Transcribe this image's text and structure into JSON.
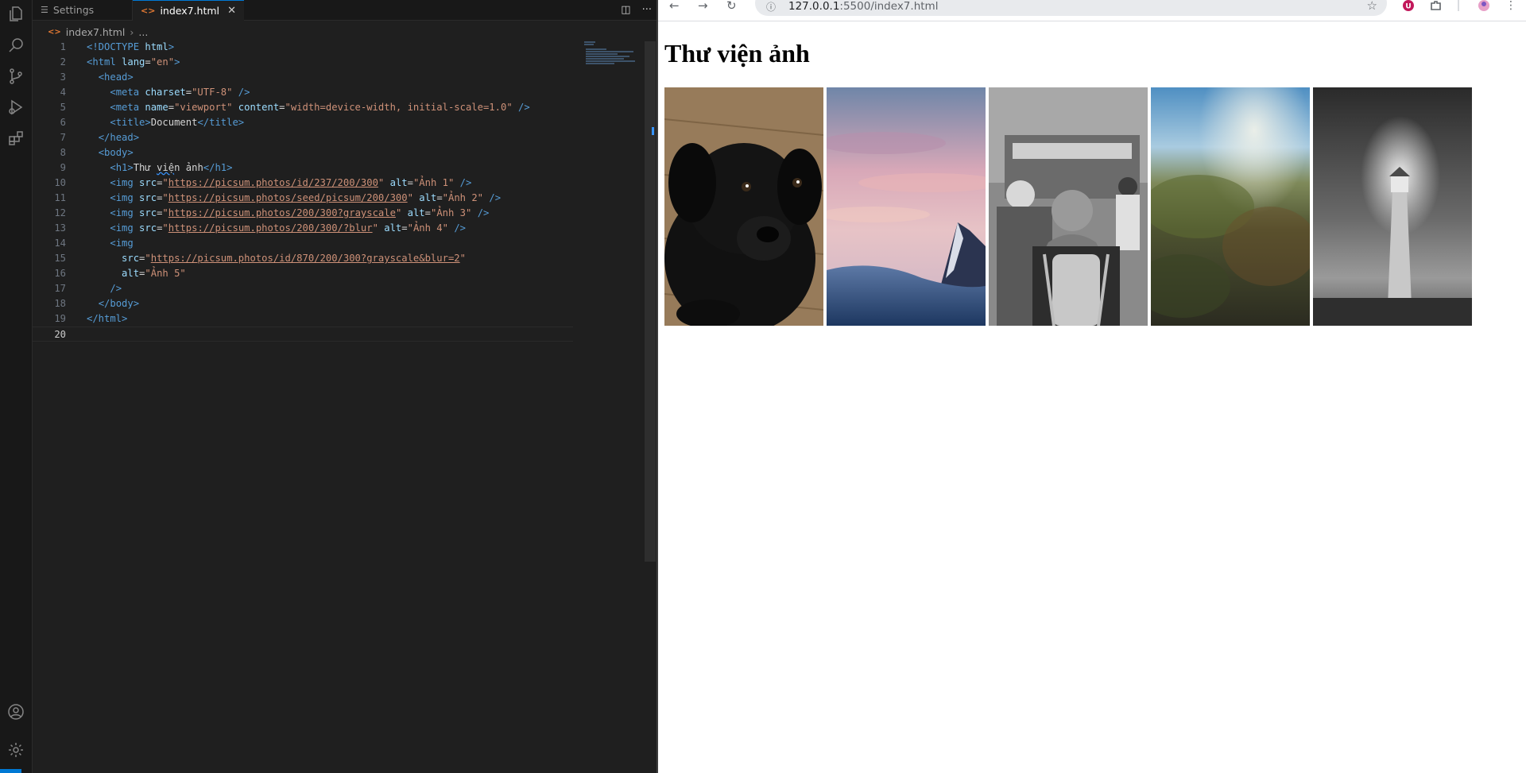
{
  "editor": {
    "tabs": [
      {
        "label": "Settings"
      },
      {
        "label": "index7.html"
      }
    ],
    "breadcrumb": {
      "file": "index7.html",
      "rest": "..."
    },
    "line_numbers": [
      "1",
      "2",
      "3",
      "4",
      "5",
      "6",
      "7",
      "8",
      "9",
      "10",
      "11",
      "12",
      "13",
      "14",
      "15",
      "16",
      "17",
      "18",
      "19",
      "20"
    ],
    "code": {
      "l1": {
        "a": "<!DOCTYPE",
        "b": " html",
        "c": ">"
      },
      "l2": {
        "a": "<html",
        "b": " lang",
        "c": "=",
        "d": "\"en\"",
        "e": ">"
      },
      "l3": {
        "a": "<head>"
      },
      "l4": {
        "a": "<meta",
        "b": " charset",
        "c": "=",
        "d": "\"UTF-8\"",
        "e": " />"
      },
      "l5": {
        "a": "<meta",
        "b": " name",
        "c": "=",
        "d": "\"viewport\"",
        "f": " content",
        "g": "=",
        "h": "\"width=device-width, initial-scale=1.0\"",
        "e": " />"
      },
      "l6": {
        "a": "<title>",
        "b": "Document",
        "c": "</title>"
      },
      "l7": {
        "a": "</head>"
      },
      "l8": {
        "a": "<body>"
      },
      "l9": {
        "a": "<h1>",
        "b": "Thư ",
        "sq": "việ",
        "c": "n ảnh",
        "d": "</h1>"
      },
      "l10": {
        "a": "<img",
        "b": " src",
        "c": "=",
        "q1": "\"",
        "u": "https://picsum.photos/id/237/200/300",
        "q2": "\"",
        "f": " alt",
        "g": "=",
        "h": "\"Ảnh 1\"",
        "e": " />"
      },
      "l11": {
        "a": "<img",
        "b": " src",
        "c": "=",
        "q1": "\"",
        "u": "https://picsum.photos/seed/picsum/200/300",
        "q2": "\"",
        "f": " alt",
        "g": "=",
        "h": "\"Ảnh 2\"",
        "e": " />"
      },
      "l12": {
        "a": "<img",
        "b": " src",
        "c": "=",
        "q1": "\"",
        "u": "https://picsum.photos/200/300?grayscale",
        "q2": "\"",
        "f": " alt",
        "g": "=",
        "h": "\"Ảnh 3\"",
        "e": " />"
      },
      "l13": {
        "a": "<img",
        "b": " src",
        "c": "=",
        "q1": "\"",
        "u": "https://picsum.photos/200/300/?blur",
        "q2": "\"",
        "f": " alt",
        "g": "=",
        "h": "\"Ảnh 4\"",
        "e": " />"
      },
      "l14": {
        "a": "<img"
      },
      "l15": {
        "b": "src",
        "c": "=",
        "q1": "\"",
        "u": "https://picsum.photos/id/870/200/300?grayscale&blur=2",
        "q2": "\""
      },
      "l16": {
        "b": "alt",
        "c": "=",
        "h": "\"Ảnh 5\""
      },
      "l17": {
        "a": "/>"
      },
      "l18": {
        "a": "</body>"
      },
      "l19": {
        "a": "</html>"
      }
    }
  },
  "browser": {
    "url_host": "127.0.0.1",
    "url_path": ":5500/index7.html",
    "page_heading": "Thư viện ảnh",
    "images": [
      {
        "alt": "Ảnh 1"
      },
      {
        "alt": "Ảnh 2"
      },
      {
        "alt": "Ảnh 3"
      },
      {
        "alt": "Ảnh 4"
      },
      {
        "alt": "Ảnh 5"
      }
    ]
  },
  "icons": {
    "activity_bar": [
      "explorer-icon",
      "search-icon",
      "source-control-icon",
      "run-debug-icon",
      "extensions-icon",
      "account-icon",
      "manage-gear-icon"
    ],
    "browser_toolbar": [
      "back-icon",
      "forward-icon",
      "reload-icon",
      "site-info-icon",
      "bookmark-star-icon",
      "extension-badge-icon",
      "extensions-puzzle-icon",
      "profile-icon",
      "menu-icon"
    ]
  },
  "colors": {
    "editor_bg": "#1f1f1f",
    "tag": "#569cd6",
    "attribute": "#9cdcfe",
    "string": "#ce9178",
    "accent": "#0078d4"
  }
}
